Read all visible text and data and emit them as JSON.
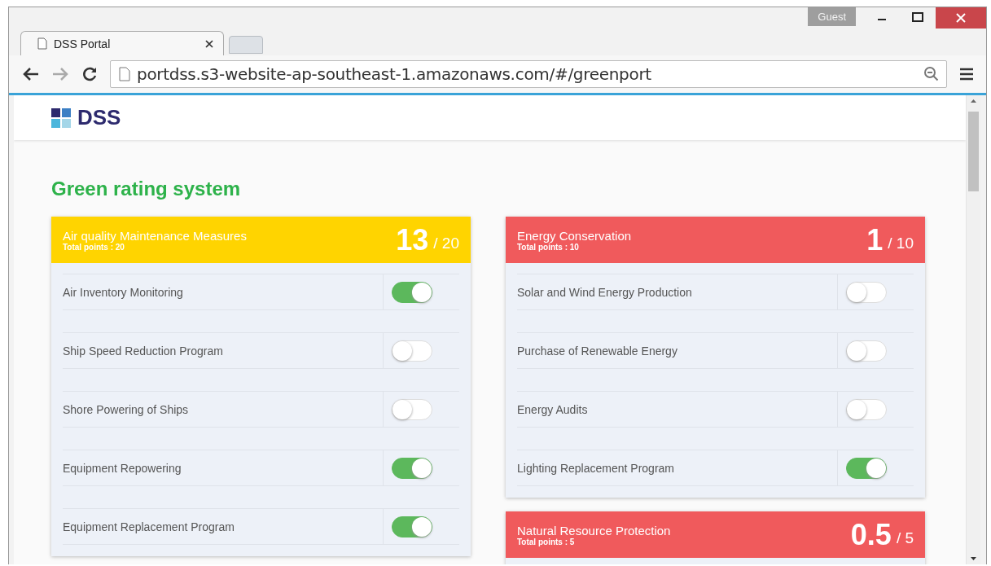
{
  "browser": {
    "tab_title": "DSS Portal",
    "user": "Guest",
    "url": "portdss.s3-website-ap-southeast-1.amazonaws.com/#/greenport"
  },
  "header": {
    "logo": "DSS"
  },
  "page_title": "Green rating system",
  "columns": [
    [
      {
        "title": "Air quality Maintenance Measures",
        "total": "Total points : 20",
        "score": "13",
        "max": "/ 20",
        "color": "#ffd400",
        "items": [
          {
            "label": "Air Inventory Monitoring",
            "on": true
          },
          {
            "label": "Ship Speed Reduction Program",
            "on": false
          },
          {
            "label": "Shore Powering of Ships",
            "on": false
          },
          {
            "label": "Equipment Repowering",
            "on": true
          },
          {
            "label": "Equipment Replacement Program",
            "on": true
          }
        ]
      }
    ],
    [
      {
        "title": "Energy Conservation",
        "total": "Total points : 10",
        "score": "1",
        "max": "/ 10",
        "color": "#f05a5c",
        "items": [
          {
            "label": "Solar and Wind Energy Production",
            "on": false
          },
          {
            "label": "Purchase of Renewable Energy",
            "on": false
          },
          {
            "label": "Energy Audits",
            "on": false
          },
          {
            "label": "Lighting Replacement Program",
            "on": true
          }
        ]
      },
      {
        "title": "Natural Resource Protection",
        "total": "Total points : 5",
        "score": "0.5",
        "max": "/ 5",
        "color": "#f05a5c"
      }
    ]
  ]
}
